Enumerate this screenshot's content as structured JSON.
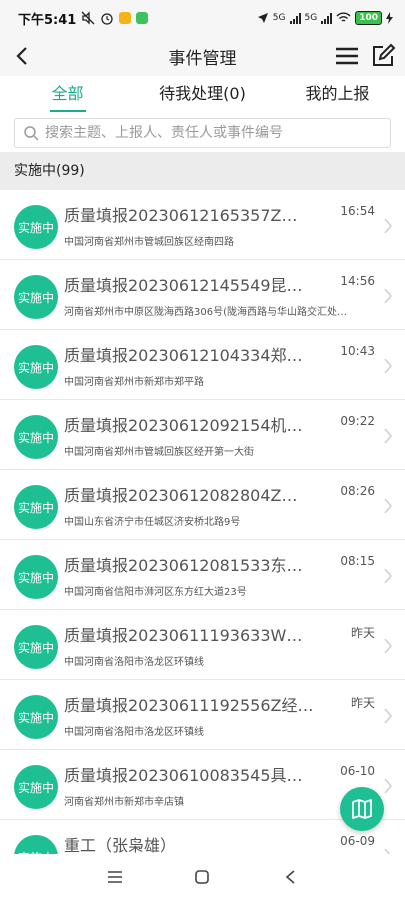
{
  "status_bar": {
    "time": "下午5:41",
    "battery": "100",
    "network_1": "5G",
    "network_2": "5G"
  },
  "header": {
    "title": "事件管理"
  },
  "tabs": [
    {
      "label": "全部",
      "active": true
    },
    {
      "label": "待我处理(0)",
      "active": false
    },
    {
      "label": "我的上报",
      "active": false
    }
  ],
  "search": {
    "placeholder": "搜索主题、上报人、责任人或事件编号"
  },
  "section": {
    "label": "实施中(99)"
  },
  "items": [
    {
      "status": "实施中",
      "title": "质量填报20230612165357Z…",
      "time": "16:54",
      "address": "中国河南省郑州市管城回族区经南四路"
    },
    {
      "status": "实施中",
      "title": "质量填报20230612145549昆…",
      "time": "14:56",
      "address": "河南省郑州市中原区陇海西路306号(陇海西路与华山路交汇处…"
    },
    {
      "status": "实施中",
      "title": "质量填报20230612104334郑…",
      "time": "10:43",
      "address": "中国河南省郑州市新郑市郑平路"
    },
    {
      "status": "实施中",
      "title": "质量填报20230612092154机…",
      "time": "09:22",
      "address": "中国河南省郑州市管城回族区经开第一大街"
    },
    {
      "status": "实施中",
      "title": "质量填报20230612082804Z…",
      "time": "08:26",
      "address": "中国山东省济宁市任城区济安桥北路9号"
    },
    {
      "status": "实施中",
      "title": "质量填报20230612081533东…",
      "time": "08:15",
      "address": "中国河南省信阳市浉河区东方红大道23号"
    },
    {
      "status": "实施中",
      "title": "质量填报20230611193633W…",
      "time": "昨天",
      "address": "中国河南省洛阳市洛龙区环镇线"
    },
    {
      "status": "实施中",
      "title": "质量填报20230611192556Z经…",
      "time": "昨天",
      "address": "中国河南省洛阳市洛龙区环镇线"
    },
    {
      "status": "实施中",
      "title": "质量填报20230610083545具…",
      "time": "06-10",
      "address": "河南省郑州市新郑市辛店镇"
    },
    {
      "status": "实施中",
      "title": "重工（张枭雄）",
      "time": "06-09",
      "address": ""
    }
  ],
  "colors": {
    "accent": "#19ae8b",
    "badge": "#1dbf93"
  },
  "icons": {
    "back": "chevron-left-icon",
    "menu": "hamburger-menu-icon",
    "edit": "edit-icon",
    "search": "search-icon",
    "fab": "map-icon"
  }
}
